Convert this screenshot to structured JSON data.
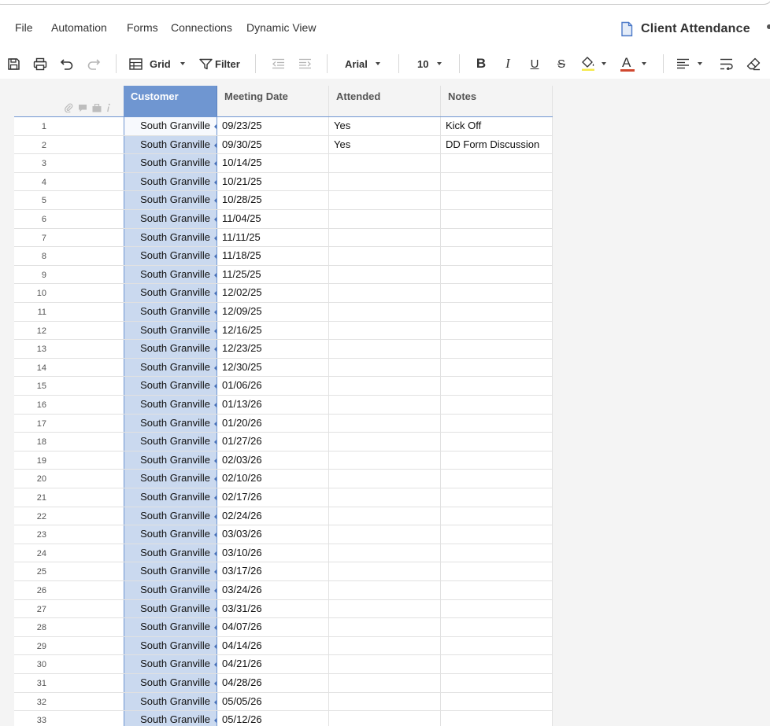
{
  "menu": [
    "File",
    "Automation",
    "Forms",
    "Connections",
    "Dynamic View"
  ],
  "sheet_title": "Client Attendance",
  "toolbar": {
    "view_label": "Grid",
    "filter_label": "Filter",
    "font_name": "Arial",
    "font_size": "10",
    "bold_glyph": "B",
    "italic_glyph": "I",
    "underline_glyph": "U",
    "strike_glyph": "S",
    "text_color_glyph": "A"
  },
  "colors": {
    "selected_header": "#6f96d1",
    "selected_column": "#cad9ef",
    "fill_underline": "#f5e94a",
    "text_color_underline": "#d0482f",
    "title_icon": "#4a78c8"
  },
  "columns": [
    "Customer",
    "Meeting Date",
    "Attended",
    "Notes"
  ],
  "rows": [
    {
      "n": "1",
      "customer": "South Granville",
      "date": "09/23/25",
      "attended": "Yes",
      "notes": "Kick Off"
    },
    {
      "n": "2",
      "customer": "South Granville",
      "date": "09/30/25",
      "attended": "Yes",
      "notes": "DD Form Discussion"
    },
    {
      "n": "3",
      "customer": "South Granville",
      "date": "10/14/25",
      "attended": "",
      "notes": ""
    },
    {
      "n": "4",
      "customer": "South Granville",
      "date": "10/21/25",
      "attended": "",
      "notes": ""
    },
    {
      "n": "5",
      "customer": "South Granville",
      "date": "10/28/25",
      "attended": "",
      "notes": ""
    },
    {
      "n": "6",
      "customer": "South Granville",
      "date": "11/04/25",
      "attended": "",
      "notes": ""
    },
    {
      "n": "7",
      "customer": "South Granville",
      "date": "11/11/25",
      "attended": "",
      "notes": ""
    },
    {
      "n": "8",
      "customer": "South Granville",
      "date": "11/18/25",
      "attended": "",
      "notes": ""
    },
    {
      "n": "9",
      "customer": "South Granville",
      "date": "11/25/25",
      "attended": "",
      "notes": ""
    },
    {
      "n": "10",
      "customer": "South Granville",
      "date": "12/02/25",
      "attended": "",
      "notes": ""
    },
    {
      "n": "11",
      "customer": "South Granville",
      "date": "12/09/25",
      "attended": "",
      "notes": ""
    },
    {
      "n": "12",
      "customer": "South Granville",
      "date": "12/16/25",
      "attended": "",
      "notes": ""
    },
    {
      "n": "13",
      "customer": "South Granville",
      "date": "12/23/25",
      "attended": "",
      "notes": ""
    },
    {
      "n": "14",
      "customer": "South Granville",
      "date": "12/30/25",
      "attended": "",
      "notes": ""
    },
    {
      "n": "15",
      "customer": "South Granville",
      "date": "01/06/26",
      "attended": "",
      "notes": ""
    },
    {
      "n": "16",
      "customer": "South Granville",
      "date": "01/13/26",
      "attended": "",
      "notes": ""
    },
    {
      "n": "17",
      "customer": "South Granville",
      "date": "01/20/26",
      "attended": "",
      "notes": ""
    },
    {
      "n": "18",
      "customer": "South Granville",
      "date": "01/27/26",
      "attended": "",
      "notes": ""
    },
    {
      "n": "19",
      "customer": "South Granville",
      "date": "02/03/26",
      "attended": "",
      "notes": ""
    },
    {
      "n": "20",
      "customer": "South Granville",
      "date": "02/10/26",
      "attended": "",
      "notes": ""
    },
    {
      "n": "21",
      "customer": "South Granville",
      "date": "02/17/26",
      "attended": "",
      "notes": ""
    },
    {
      "n": "22",
      "customer": "South Granville",
      "date": "02/24/26",
      "attended": "",
      "notes": ""
    },
    {
      "n": "23",
      "customer": "South Granville",
      "date": "03/03/26",
      "attended": "",
      "notes": ""
    },
    {
      "n": "24",
      "customer": "South Granville",
      "date": "03/10/26",
      "attended": "",
      "notes": ""
    },
    {
      "n": "25",
      "customer": "South Granville",
      "date": "03/17/26",
      "attended": "",
      "notes": ""
    },
    {
      "n": "26",
      "customer": "South Granville",
      "date": "03/24/26",
      "attended": "",
      "notes": ""
    },
    {
      "n": "27",
      "customer": "South Granville",
      "date": "03/31/26",
      "attended": "",
      "notes": ""
    },
    {
      "n": "28",
      "customer": "South Granville",
      "date": "04/07/26",
      "attended": "",
      "notes": ""
    },
    {
      "n": "29",
      "customer": "South Granville",
      "date": "04/14/26",
      "attended": "",
      "notes": ""
    },
    {
      "n": "30",
      "customer": "South Granville",
      "date": "04/21/26",
      "attended": "",
      "notes": ""
    },
    {
      "n": "31",
      "customer": "South Granville",
      "date": "04/28/26",
      "attended": "",
      "notes": ""
    },
    {
      "n": "32",
      "customer": "South Granville",
      "date": "05/05/26",
      "attended": "",
      "notes": ""
    },
    {
      "n": "33",
      "customer": "South Granville",
      "date": "05/12/26",
      "attended": "",
      "notes": ""
    }
  ]
}
